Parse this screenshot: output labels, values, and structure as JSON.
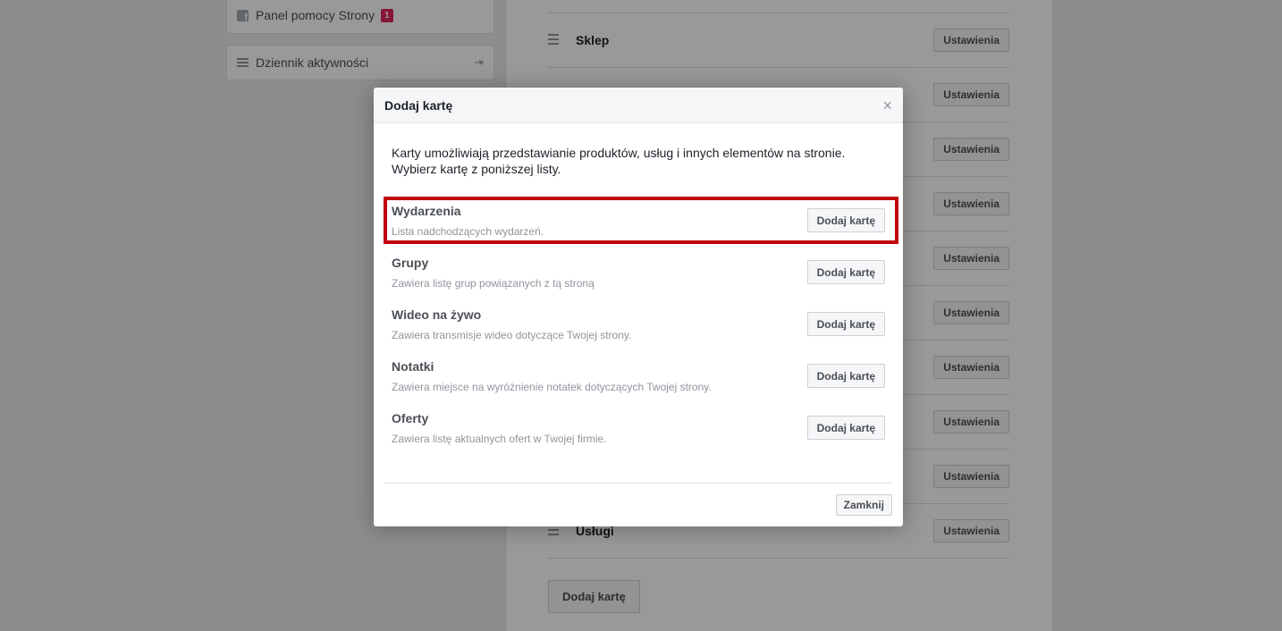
{
  "left_menu": {
    "help_label": "Panel pomocy Strony",
    "help_badge": "1",
    "log_label": "Dziennik aktywności"
  },
  "tabs": {
    "shop_label": "Sklep",
    "services_label": "Usługi",
    "settings_label": "Ustawienia",
    "add_tab_label": "Dodaj kartę"
  },
  "dialog": {
    "title": "Dodaj kartę",
    "close_glyph": "×",
    "intro": "Karty umożliwiają przedstawianie produktów, usług i innych elementów na stronie. Wybierz kartę z poniższej listy.",
    "items": [
      {
        "name": "Wydarzenia",
        "desc": "Lista nadchodzących wydarzeń.",
        "button": "Dodaj kartę"
      },
      {
        "name": "Grupy",
        "desc": "Zawiera listę grup powiązanych z tą stroną",
        "button": "Dodaj kartę"
      },
      {
        "name": "Wideo na żywo",
        "desc": "Zawiera transmisje wideo dotyczące Twojej strony.",
        "button": "Dodaj kartę"
      },
      {
        "name": "Notatki",
        "desc": "Zawiera miejsce na wyróżnienie notatek dotyczących Twojej strony.",
        "button": "Dodaj kartę"
      },
      {
        "name": "Oferty",
        "desc": "Zawiera listę aktualnych ofert w Twojej firmie.",
        "button": "Dodaj kartę"
      }
    ],
    "close_button": "Zamknij"
  },
  "colors": {
    "highlight": "#c0000c",
    "badge": "#e0245e"
  }
}
